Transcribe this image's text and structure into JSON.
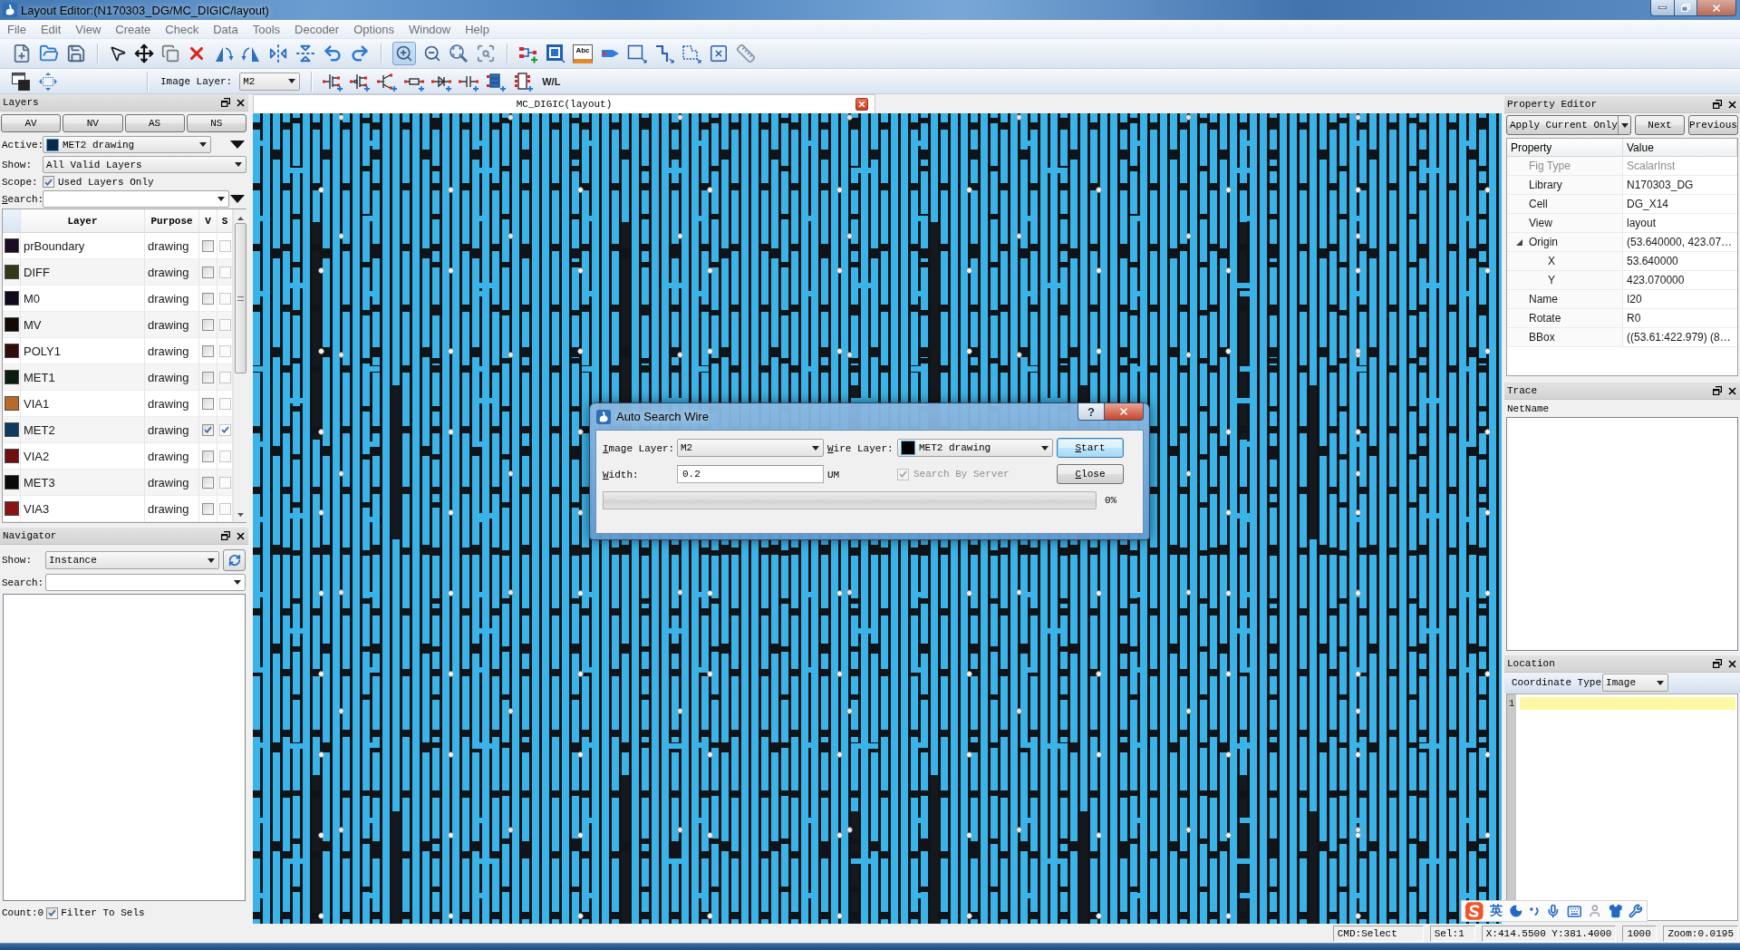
{
  "window": {
    "title": "Layout Editor:(N170303_DG/MC_DIGIC/layout)"
  },
  "menu": [
    "File",
    "Edit",
    "View",
    "Create",
    "Check",
    "Data",
    "Tools",
    "Decoder",
    "Options",
    "Window",
    "Help"
  ],
  "toolbar": {
    "zoom_in": {
      "pressed": true
    },
    "label_tool": "Abc",
    "image_layer": {
      "label": "Image Layer:",
      "value": "M2"
    },
    "wl": "W/L"
  },
  "layers_panel": {
    "title": "Layers",
    "buttons": [
      "AV",
      "NV",
      "AS",
      "NS"
    ],
    "active": {
      "label": "Active:",
      "value": "MET2 drawing"
    },
    "show": {
      "label": "Show:",
      "value": "All Valid Layers"
    },
    "scope": {
      "label": "Scope:",
      "option": "Used Layers Only",
      "checked": true
    },
    "search": {
      "label": "Search:",
      "mnemonic": true
    },
    "table": {
      "columns": [
        "Layer",
        "Purpose",
        "V",
        "S"
      ],
      "rows": [
        {
          "layer": "prBoundary",
          "purpose": "drawing",
          "color": "#1b0c24",
          "v_checked": false,
          "s_checked": false
        },
        {
          "layer": "DIFF",
          "purpose": "drawing",
          "color": "#35361a",
          "v_checked": false,
          "s_checked": false
        },
        {
          "layer": "M0",
          "purpose": "drawing",
          "color": "#100a1c",
          "v_checked": false,
          "s_checked": false
        },
        {
          "layer": "MV",
          "purpose": "drawing",
          "color": "#140a04",
          "v_checked": false,
          "s_checked": false
        },
        {
          "layer": "POLY1",
          "purpose": "drawing",
          "color": "#2e0d0a",
          "v_checked": false,
          "s_checked": false
        },
        {
          "layer": "MET1",
          "purpose": "drawing",
          "color": "#0c1c0e",
          "v_checked": false,
          "s_checked": false
        },
        {
          "layer": "VIA1",
          "purpose": "drawing",
          "color": "#b86a2a",
          "v_checked": false,
          "s_checked": false
        },
        {
          "layer": "MET2",
          "purpose": "drawing",
          "color": "#0e3a60",
          "v_checked": true,
          "s_checked": true
        },
        {
          "layer": "VIA2",
          "purpose": "drawing",
          "color": "#6e0f10",
          "v_checked": false,
          "s_checked": false
        },
        {
          "layer": "MET3",
          "purpose": "drawing",
          "color": "#0a0a06",
          "v_checked": false,
          "s_checked": false
        },
        {
          "layer": "VIA3",
          "purpose": "drawing",
          "color": "#8a1414",
          "v_checked": false,
          "s_checked": false
        }
      ]
    }
  },
  "navigator": {
    "title": "Navigator",
    "show": {
      "label": "Show:",
      "value": "Instance"
    },
    "search": {
      "label": "Search:"
    },
    "count": "Count:0",
    "filter": {
      "label": "Filter To Sels",
      "checked": true
    }
  },
  "document_tab": {
    "title": "MC_DIGIC(layout)"
  },
  "dialog": {
    "title": "Auto Search Wire",
    "help": "?",
    "image_layer": {
      "label": "Image Layer:",
      "value": "M2",
      "mnemonic": true
    },
    "wire_layer": {
      "label": "Wire Layer:",
      "value": "MET2 drawing",
      "mnemonic": true
    },
    "width": {
      "label": "Width:",
      "value": "0.2",
      "unit": "UM",
      "mnemonic": true
    },
    "search_by_server": {
      "label": "Search By Server",
      "checked": true,
      "disabled": true
    },
    "buttons": [
      {
        "label": "Start",
        "default": true,
        "mnemonic": true
      },
      {
        "label": "Close",
        "default": false,
        "mnemonic": true
      }
    ],
    "progress": {
      "level": 0,
      "reading": "0%"
    }
  },
  "property_editor": {
    "title": "Property Editor",
    "apply": "Apply Current Only",
    "buttons": [
      "Next",
      "Previous"
    ],
    "columns": [
      "Property",
      "Value"
    ],
    "rows": [
      {
        "property": "Fig Type",
        "value": "ScalarInst",
        "disabled": true
      },
      {
        "property": "Library",
        "value": "N170303_DG",
        "disabled": false
      },
      {
        "property": "Cell",
        "value": "DG_X14",
        "disabled": false
      },
      {
        "property": "View",
        "value": "layout",
        "disabled": false
      },
      {
        "property": "Origin",
        "value": "(53.640000, 423.07…",
        "disabled": false,
        "expanded": true,
        "children": [
          {
            "property": "X",
            "value": "53.640000",
            "disabled": false
          },
          {
            "property": "Y",
            "value": "423.070000",
            "disabled": false
          }
        ]
      },
      {
        "property": "Name",
        "value": "I20",
        "disabled": false
      },
      {
        "property": "Rotate",
        "value": "R0",
        "disabled": false
      },
      {
        "property": "BBox",
        "value": "((53.61:422.979) (8…",
        "disabled": false
      }
    ]
  },
  "trace": {
    "title": "Trace",
    "column": "NetName"
  },
  "location": {
    "title": "Location",
    "coordinate_type": {
      "label": "Coordinate Type",
      "value": "Image"
    },
    "line_numbers": [
      "1"
    ]
  },
  "ime_bar": {
    "mode": "英"
  },
  "status_bar": [
    "CMD:Select",
    "Sel:1",
    "X:414.5500 Y:381.4000",
    "1000",
    "Zoom:0.0195"
  ]
}
